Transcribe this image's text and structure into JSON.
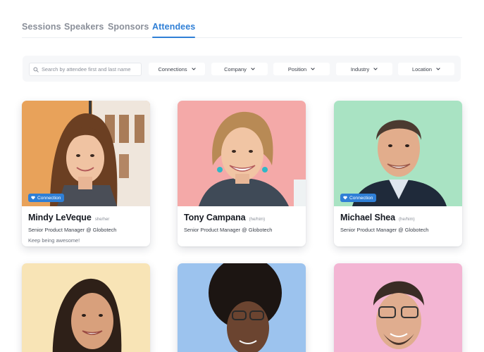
{
  "tabs": [
    {
      "label": "Sessions"
    },
    {
      "label": "Speakers"
    },
    {
      "label": "Sponsors"
    },
    {
      "label": "Attendees"
    }
  ],
  "filters": {
    "search_placeholder": "Search by attendee first and last name",
    "dropdowns": [
      {
        "label": "Connections",
        "icon": "chevron-down-icon"
      },
      {
        "label": "Company",
        "icon": "chevron-down-icon"
      },
      {
        "label": "Position",
        "icon": "chevron-down-icon"
      },
      {
        "label": "Industry",
        "icon": "chevron-down-icon"
      },
      {
        "label": "Location",
        "icon": "chevron-down-icon"
      }
    ]
  },
  "attendees": [
    {
      "name": "Mindy LeVeque",
      "pronouns": "she/her",
      "role": "Senior Product Manager @ Globotech",
      "note": "Keep being awesome!",
      "badge": "Connection",
      "bg": "#e8a25a"
    },
    {
      "name": "Tony Campana",
      "pronouns": "(he/him)",
      "role": "Senior Product Manager @ Globotech",
      "bg": "#f4a9a8"
    },
    {
      "name": "Michael Shea",
      "pronouns": "(he/him)",
      "role": "Senior Product Manager @ Globotech",
      "badge": "Connection",
      "bg": "#a9e3c3"
    },
    {
      "bg": "#f8e4b6"
    },
    {
      "bg": "#9cc3ee"
    },
    {
      "bg": "#f3b5d3"
    }
  ],
  "colors": {
    "accent": "#2f7fd6",
    "badge": "#2f7fd6"
  }
}
